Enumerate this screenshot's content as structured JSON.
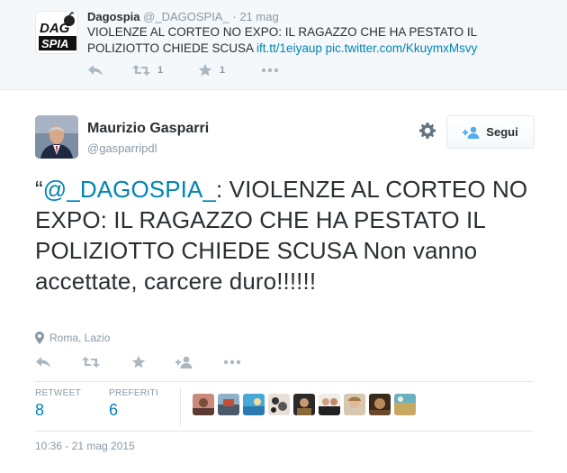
{
  "quoted_tweet": {
    "avatar_logo": "DAGOSPIA",
    "name": "Dagospia",
    "handle": "@_DAGOSPIA_",
    "separator": "·",
    "time": "21 mag",
    "text": "VIOLENZE AL CORTEO NO EXPO: IL RAGAZZO CHE HA PESTATO IL POLIZIOTTO CHIEDE SCUSA ",
    "links": "ift.tt/1eiyaup pic.twitter.com/KkuymxMsvy",
    "retweet_count": "1",
    "favorite_count": "1",
    "icons": [
      "reply-icon",
      "retweet-icon",
      "star-icon",
      "more-icon"
    ]
  },
  "tweet": {
    "name": "Maurizio Gasparri",
    "handle": "@gasparripdl",
    "follow_label": "Segui",
    "open_quote": "“",
    "mention": "@_DAGOSPIA_",
    "text": ": VIOLENZE AL CORTEO NO EXPO: IL RAGAZZO CHE HA PESTATO IL POLIZIOTTO CHIEDE SCUSA Non vanno accettate, carcere duro!!!!!!",
    "location": "Roma, Lazio",
    "icons": [
      "reply-icon",
      "retweet-icon",
      "star-icon",
      "follow-icon",
      "more-icon"
    ],
    "stats": {
      "retweet_label": "RETWEET",
      "retweet_value": "8",
      "favorites_label": "PREFERITI",
      "favorites_value": "6"
    },
    "timestamp": "10:36 - 21 mag 2015"
  },
  "colors": {
    "link": "#0084b4",
    "muted": "#8899a6",
    "icon": "#aab8c2",
    "text": "#292f33",
    "top_background": "#f5f8fa"
  }
}
